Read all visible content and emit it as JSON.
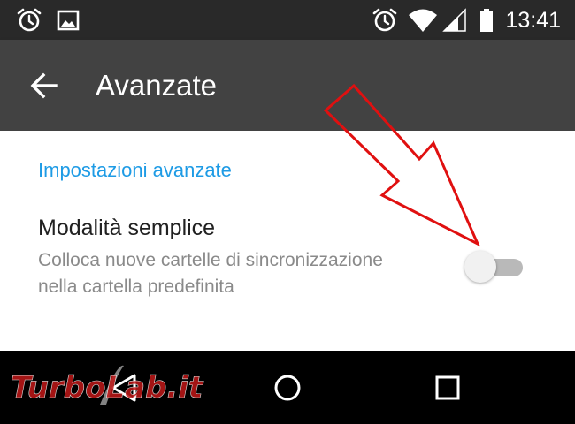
{
  "status_bar": {
    "time": "13:41",
    "left_icons": [
      "alarm-icon",
      "image-icon"
    ],
    "right_icons": [
      "alarm-icon",
      "wifi-icon",
      "signal-icon",
      "battery-icon"
    ]
  },
  "app_bar": {
    "title": "Avanzate",
    "back_icon": "arrow-left-icon"
  },
  "content": {
    "section_header": "Impostazioni avanzate",
    "preference": {
      "title": "Modalità semplice",
      "summary": "Colloca nuove cartelle di sincronizzazione nella cartella predefinita",
      "toggle_on": false
    }
  },
  "nav_bar": {
    "icons": [
      "back-triangle-icon",
      "home-circle-icon",
      "recents-square-icon"
    ]
  },
  "watermark": {
    "text": "TurboLab.it"
  },
  "colors": {
    "status_bar": "#292929",
    "app_bar": "#424242",
    "accent": "#1e9be5",
    "annotation": "#e01010"
  }
}
